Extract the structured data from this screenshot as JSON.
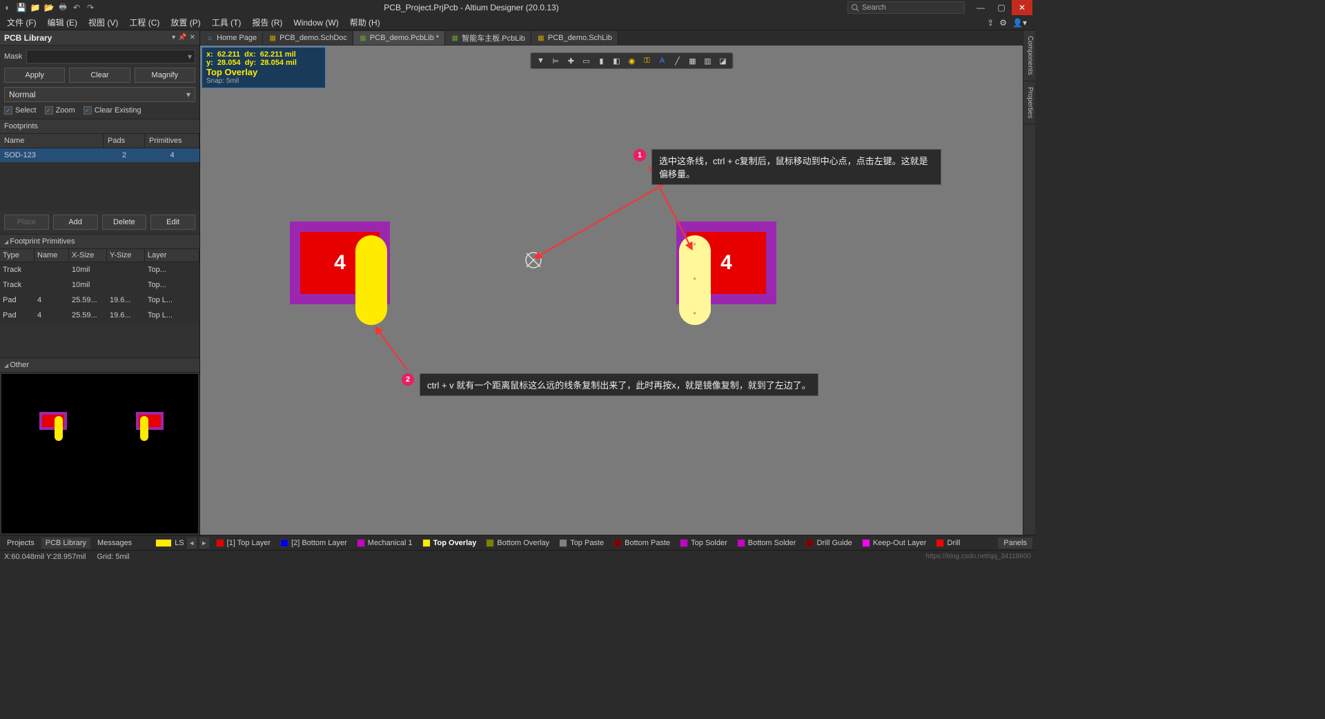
{
  "titlebar": {
    "title": "PCB_Project.PrjPcb - Altium Designer (20.0.13)",
    "search_placeholder": "Search"
  },
  "menu": {
    "items": [
      "文件 (F)",
      "编辑 (E)",
      "视图 (V)",
      "工程 (C)",
      "放置 (P)",
      "工具 (T)",
      "报告 (R)",
      "Window (W)",
      "帮助 (H)"
    ]
  },
  "panel": {
    "title": "PCB Library",
    "mask_label": "Mask",
    "apply": "Apply",
    "clear": "Clear",
    "magnify": "Magnify",
    "mode": "Normal",
    "select": "Select",
    "zoom": "Zoom",
    "clear_existing": "Clear Existing",
    "footprints_label": "Footprints",
    "fp_headers": {
      "name": "Name",
      "pads": "Pads",
      "primitives": "Primitives"
    },
    "fp_rows": [
      {
        "name": "SOD-123",
        "pads": "2",
        "primitives": "4"
      }
    ],
    "place": "Place",
    "add": "Add",
    "delete": "Delete",
    "edit": "Edit",
    "primitives_title": "Footprint Primitives",
    "prim_headers": {
      "type": "Type",
      "name": "Name",
      "xsize": "X-Size",
      "ysize": "Y-Size",
      "layer": "Layer"
    },
    "prim_rows": [
      {
        "type": "Track",
        "name": "",
        "xsize": "10mil",
        "ysize": "",
        "layer": "Top..."
      },
      {
        "type": "Track",
        "name": "",
        "xsize": "10mil",
        "ysize": "",
        "layer": "Top..."
      },
      {
        "type": "Pad",
        "name": "4",
        "xsize": "25.59...",
        "ysize": "19.6...",
        "layer": "Top L..."
      },
      {
        "type": "Pad",
        "name": "4",
        "xsize": "25.59...",
        "ysize": "19.6...",
        "layer": "Top L..."
      }
    ],
    "other_title": "Other"
  },
  "tabs": [
    {
      "label": "Home Page",
      "icon": "home"
    },
    {
      "label": "PCB_demo.SchDoc",
      "icon": "doc"
    },
    {
      "label": "PCB_demo.PcbLib *",
      "icon": "lib",
      "active": true
    },
    {
      "label": "智能车主板.PcbLib",
      "icon": "lib"
    },
    {
      "label": "PCB_demo.SchLib",
      "icon": "lib"
    }
  ],
  "infobox": {
    "x_label": "x:",
    "x_val": "62.211",
    "dx_label": "dx:",
    "dx_val": "62.211 mil",
    "y_label": "y:",
    "y_val": "28.054",
    "dy_label": "dy:",
    "dy_val": "28.054 mil",
    "layer": "Top Overlay",
    "snap": "Snap: 5mil"
  },
  "pad_num": "4",
  "annotations": {
    "a1": "选中这条线，ctrl + c复制后，鼠标移动到中心点，点击左键。这就是偏移量。",
    "a2": "ctrl + v 就有一个距离鼠标这么远的线条复制出来了，此时再按x，就是镜像复制，就到了左边了。"
  },
  "right_tabs": [
    "Components",
    "Properties"
  ],
  "bottom_tabs": {
    "projects": "Projects",
    "pcblib": "PCB Library",
    "messages": "Messages"
  },
  "ls_label": "LS",
  "layers": [
    {
      "name": "[1] Top Layer",
      "color": "#e60000"
    },
    {
      "name": "[2] Bottom Layer",
      "color": "#0000e6"
    },
    {
      "name": "Mechanical 1",
      "color": "#c800c8"
    },
    {
      "name": "Top Overlay",
      "color": "#ffeb00",
      "active": true
    },
    {
      "name": "Bottom Overlay",
      "color": "#808000"
    },
    {
      "name": "Top Paste",
      "color": "#808080"
    },
    {
      "name": "Bottom Paste",
      "color": "#800000"
    },
    {
      "name": "Top Solder",
      "color": "#c800c8"
    },
    {
      "name": "Bottom Solder",
      "color": "#c800c8"
    },
    {
      "name": "Drill Guide",
      "color": "#800000"
    },
    {
      "name": "Keep-Out Layer",
      "color": "#ff00ff"
    },
    {
      "name": "Drill",
      "color": "#ff0000"
    }
  ],
  "status": {
    "coord": "X:60.048mil Y:28.957mil",
    "grid": "Grid: 5mil",
    "watermark": "https://blog.csdn.net/qq_34118600"
  },
  "panels_btn": "Panels"
}
